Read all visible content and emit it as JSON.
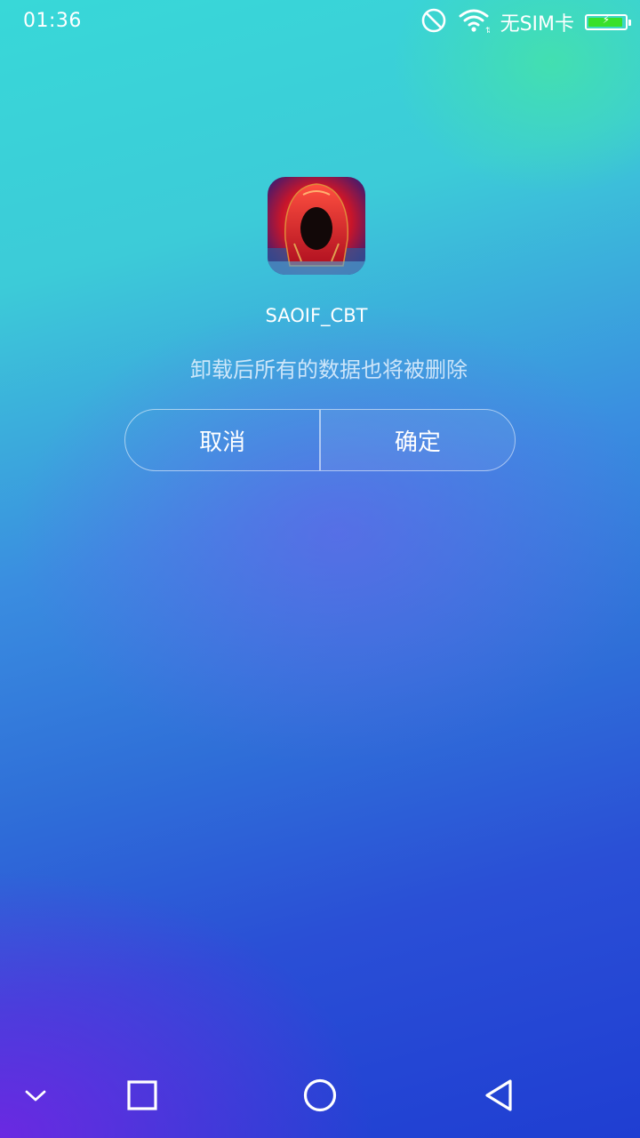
{
  "status_bar": {
    "time": "01:36",
    "sim_text": "无SIM卡",
    "battery_level": 0.95,
    "battery_charging": true,
    "icons": [
      "do-not-disturb-icon",
      "wifi-icon",
      "battery-charging-icon"
    ]
  },
  "dialog": {
    "app_name": "SAOIF_CBT",
    "message": "卸载后所有的数据也将被删除",
    "cancel_label": "取消",
    "confirm_label": "确定"
  },
  "nav_bar": {
    "icons": [
      "collapse-chevron-icon",
      "recents-square-icon",
      "home-circle-icon",
      "back-triangle-icon"
    ]
  },
  "colors": {
    "background_top": "#38d8d8",
    "background_bottom": "#1f3ed2",
    "battery_fill": "#39e02a",
    "text": "#ffffff"
  }
}
